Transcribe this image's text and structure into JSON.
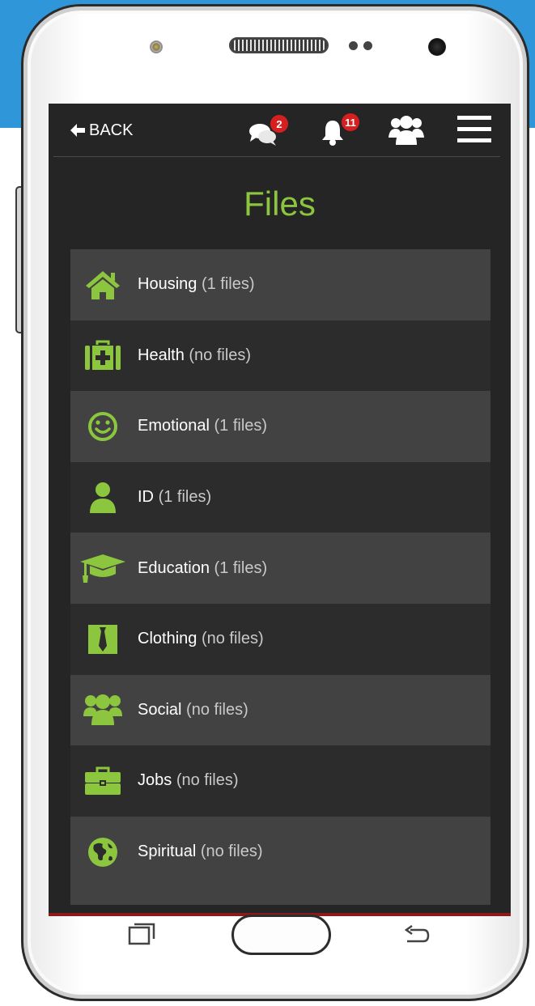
{
  "topbar": {
    "back_label": "BACK",
    "messages_badge": "2",
    "notifications_badge": "11"
  },
  "page": {
    "title": "Files"
  },
  "files": [
    {
      "icon": "home-icon",
      "name": "Housing",
      "count": "(1 files)"
    },
    {
      "icon": "medkit-icon",
      "name": "Health",
      "count": "(no files)"
    },
    {
      "icon": "smile-icon",
      "name": "Emotional",
      "count": "(1 files)"
    },
    {
      "icon": "user-icon",
      "name": "ID",
      "count": "(1 files)"
    },
    {
      "icon": "graduation-cap-icon",
      "name": "Education",
      "count": "(1 files)"
    },
    {
      "icon": "tie-icon",
      "name": "Clothing",
      "count": "(no files)"
    },
    {
      "icon": "users-icon",
      "name": "Social",
      "count": "(no files)"
    },
    {
      "icon": "briefcase-icon",
      "name": "Jobs",
      "count": "(no files)"
    },
    {
      "icon": "globe-icon",
      "name": "Spiritual",
      "count": "(no files)"
    }
  ],
  "colors": {
    "accent": "#8cc63e",
    "badge": "#d61f1f",
    "row_light": "#424242",
    "row_dark": "#2c2c2c",
    "screen_bg": "#252525",
    "backdrop_blue": "#2f97d9"
  }
}
